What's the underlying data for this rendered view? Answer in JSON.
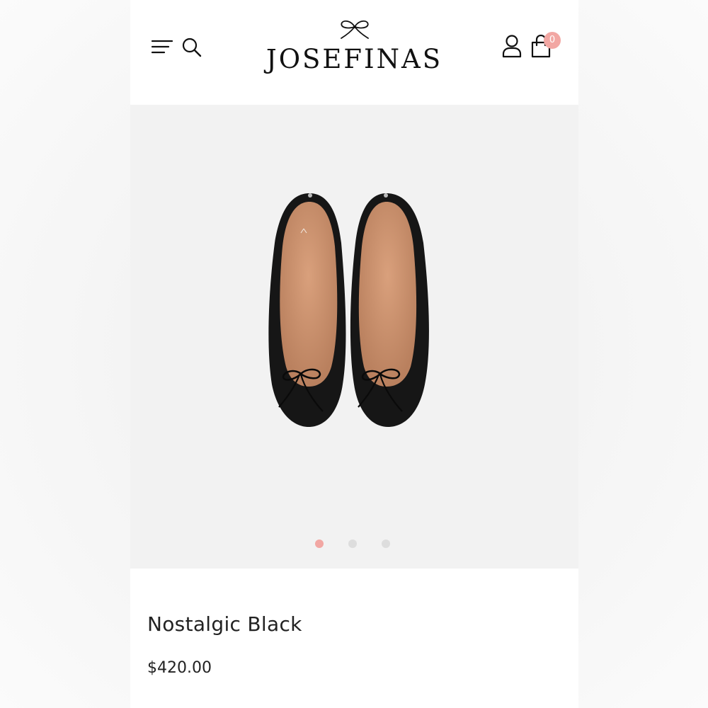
{
  "header": {
    "logo_text": "JOSEFINAS",
    "cart_count": "0",
    "icons": [
      "menu-icon",
      "search-icon",
      "account-icon",
      "shopping-bag-icon"
    ]
  },
  "gallery": {
    "image_count": 3,
    "active_index": 0
  },
  "product": {
    "name": "Nostalgic Black",
    "price": "$420.00"
  },
  "colors": {
    "accent": "#f2a7a3",
    "text": "#222222",
    "gallery_background": "#f2f2f2",
    "inactive_dot": "#dddddd"
  }
}
